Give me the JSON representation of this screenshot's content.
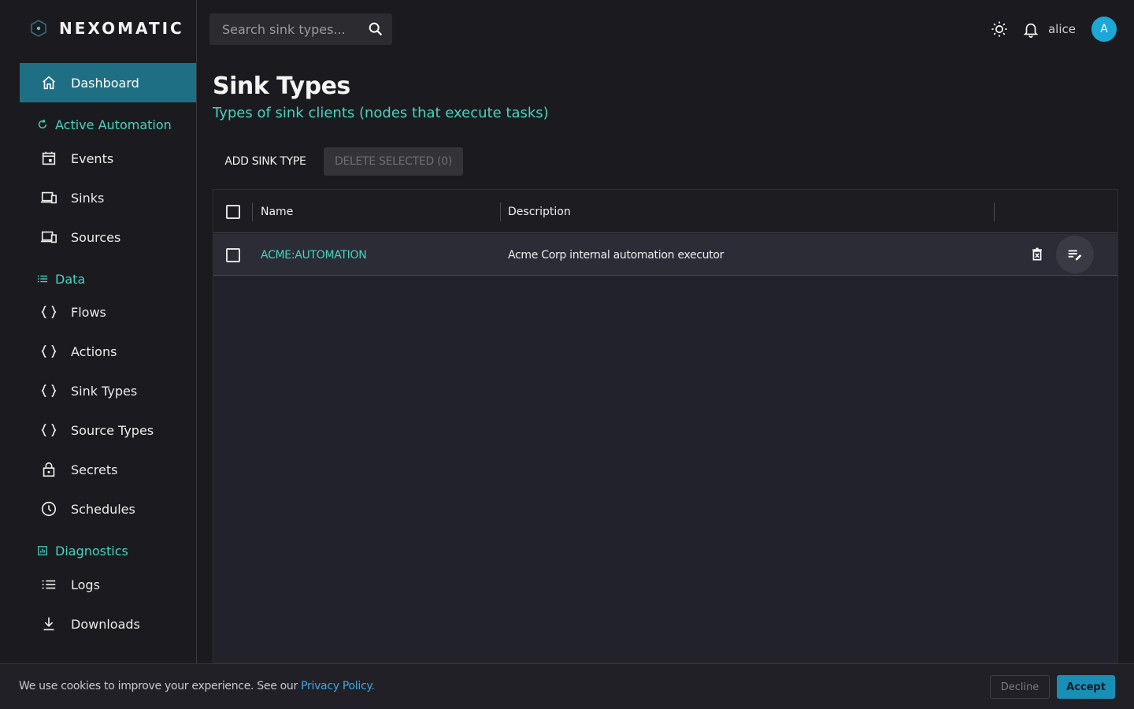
{
  "app": {
    "name": "NEXOMATIC"
  },
  "sidebar": {
    "items": [
      {
        "key": "dashboard",
        "label": "Dashboard",
        "icon": "home-icon",
        "active": true
      },
      {
        "key": "events",
        "label": "Events",
        "icon": "calendar-icon"
      },
      {
        "key": "sinks",
        "label": "Sinks",
        "icon": "devices-icon"
      },
      {
        "key": "sources",
        "label": "Sources",
        "icon": "devices-icon"
      },
      {
        "key": "flows",
        "label": "Flows",
        "icon": "braces-icon"
      },
      {
        "key": "actions",
        "label": "Actions",
        "icon": "braces-icon"
      },
      {
        "key": "sink-types",
        "label": "Sink Types",
        "icon": "braces-icon"
      },
      {
        "key": "source-types",
        "label": "Source Types",
        "icon": "braces-icon"
      },
      {
        "key": "secrets",
        "label": "Secrets",
        "icon": "lock-icon"
      },
      {
        "key": "schedules",
        "label": "Schedules",
        "icon": "clock-icon"
      },
      {
        "key": "logs",
        "label": "Logs",
        "icon": "list-icon"
      },
      {
        "key": "downloads",
        "label": "Downloads",
        "icon": "download-icon"
      }
    ],
    "sections": {
      "active_automation": "Active Automation",
      "data": "Data",
      "diagnostics": "Diagnostics"
    }
  },
  "header": {
    "search_placeholder": "Search sink types...",
    "username": "alice",
    "avatar_initial": "A"
  },
  "main": {
    "title": "Sink Types",
    "subtitle": "Types of sink clients (nodes that execute tasks)",
    "add_button": "ADD SINK TYPE",
    "delete_button": "DELETE SELECTED (0)",
    "table": {
      "columns": [
        "Name",
        "Description"
      ],
      "rows": [
        {
          "name": "ACME:AUTOMATION",
          "description": "Acme Corp internal automation executor"
        }
      ]
    }
  },
  "cookie": {
    "text": "We use cookies to improve your experience. See our ",
    "link": "Privacy Policy.",
    "decline": "Decline",
    "accept": "Accept"
  },
  "colors": {
    "accent": "#45d4c0",
    "active_nav": "#1f6f84",
    "avatar": "#1ba8d6",
    "accept_button": "#1a8fb5"
  }
}
